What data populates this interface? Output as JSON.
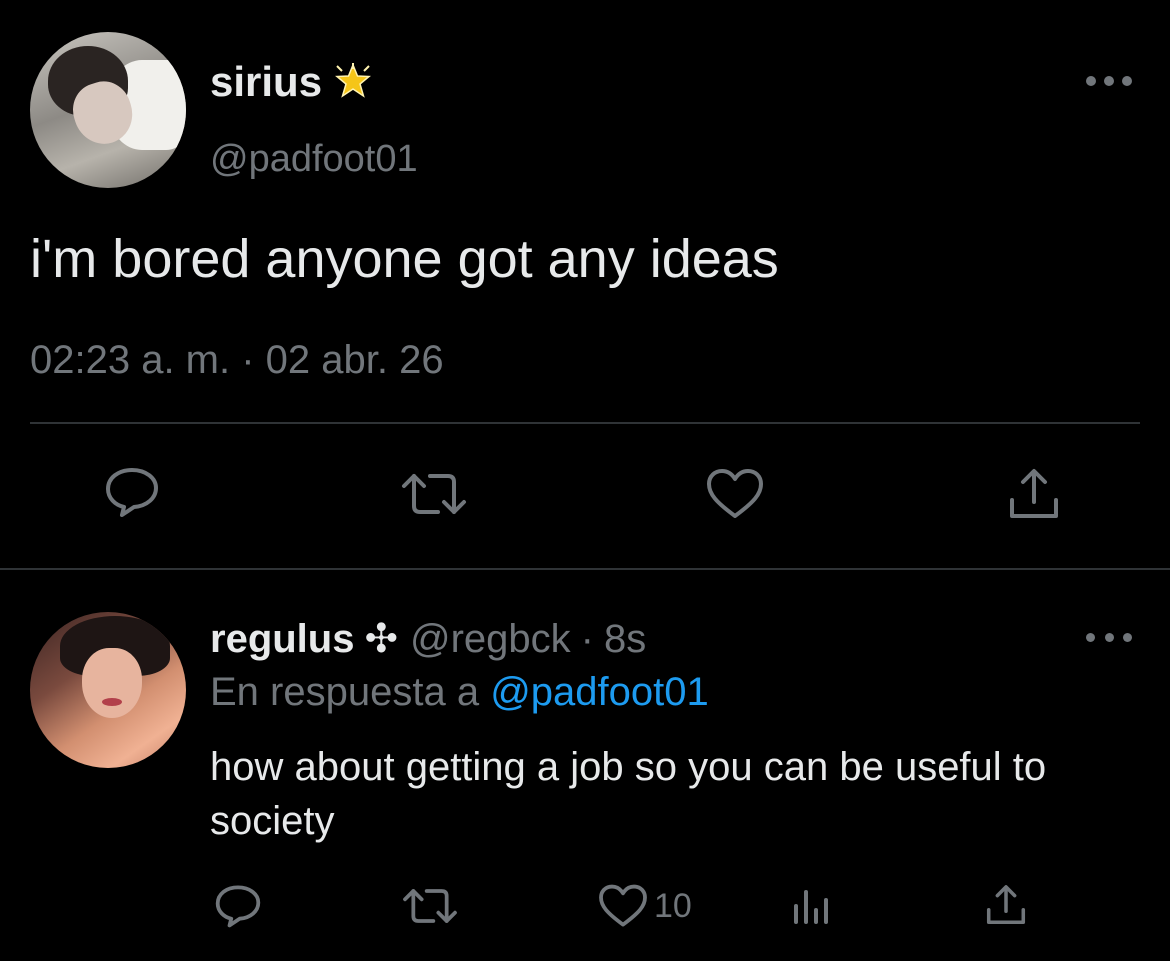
{
  "main_tweet": {
    "display_name": "sirius",
    "name_badge_icon": "sparkle-star-icon",
    "handle": "@padfoot01",
    "text": "i'm bored anyone got any ideas",
    "timestamp": "02:23 a. m. · 02 abr. 26",
    "actions": [
      "reply-icon",
      "retweet-icon",
      "like-icon",
      "share-icon"
    ]
  },
  "reply_tweet": {
    "display_name": "regulus",
    "name_symbol": "✣",
    "handle": "@regbck",
    "separator": "·",
    "time_ago": "8s",
    "context_prefix": "En respuesta a",
    "context_mention": "@padfoot01",
    "text": "how about getting a job so you can be useful to society",
    "like_count": "10",
    "actions": [
      "reply-icon",
      "retweet-icon",
      "like-icon",
      "views-icon",
      "share-icon"
    ]
  },
  "colors": {
    "background": "#000000",
    "primary_text": "#e7e9ea",
    "secondary_text": "#71767b",
    "link": "#1d9bf0",
    "divider": "#2f3336",
    "star": "#f5c518"
  }
}
